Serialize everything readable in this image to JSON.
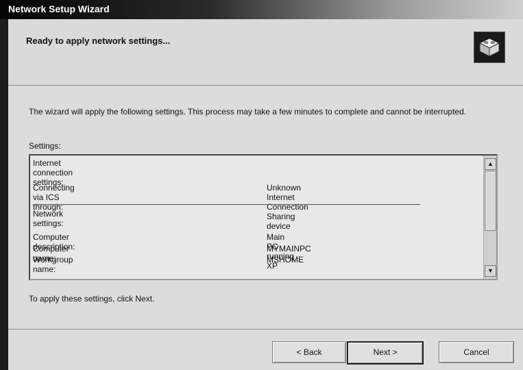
{
  "window": {
    "title": "Network Setup Wizard"
  },
  "header": {
    "heading": "Ready to apply network settings...",
    "icon": "network-wizard-icon"
  },
  "description": "The wizard will apply the following settings. This process may take a few minutes to complete and cannot be interrupted.",
  "settings_label": "Settings:",
  "settings": {
    "internet_heading": "Internet connection settings:",
    "ics_label": "Connecting via ICS through:",
    "ics_value": "Unknown Internet Connection Sharing device",
    "network_heading": "Network settings:",
    "computer_description_label": "Computer description:",
    "computer_description_value": "Main PC running XP",
    "computer_name_label": "Computer name:",
    "computer_name_value": "MYMAINPC",
    "workgroup_label": "Workgroup name:",
    "workgroup_value": "MSHOME"
  },
  "apply_note": "To apply these settings, click Next.",
  "buttons": {
    "back": "< Back",
    "next": "Next >",
    "cancel": "Cancel"
  }
}
